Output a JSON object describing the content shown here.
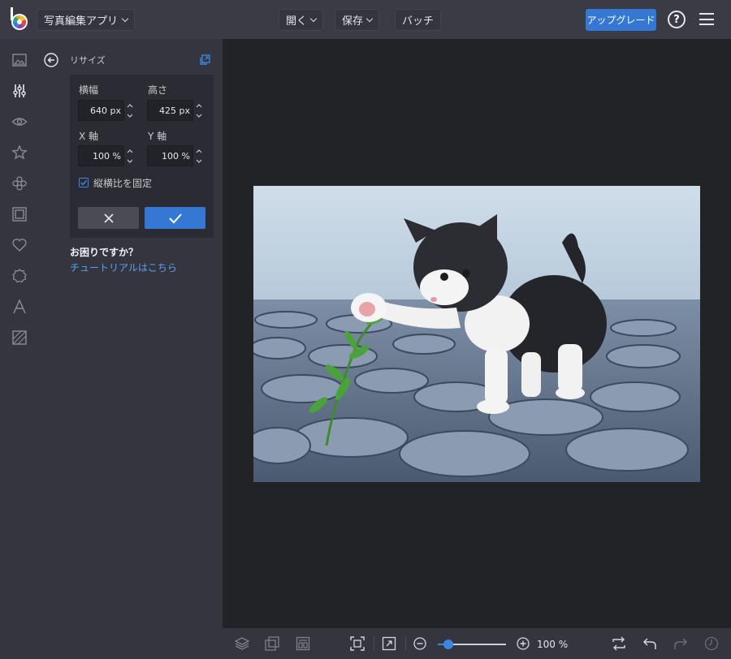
{
  "header": {
    "app_title": "写真編集アプリ",
    "open_label": "開く",
    "save_label": "保存",
    "batch_label": "バッチ",
    "upgrade_label": "アップグレード",
    "help_label": "?"
  },
  "sidebar": {
    "icons": [
      "image-icon",
      "sliders-icon",
      "eye-icon",
      "star-icon",
      "flower-icon",
      "frame-icon",
      "heart-icon",
      "badge-icon",
      "text-icon",
      "texture-icon"
    ],
    "active": "sliders-icon"
  },
  "panel": {
    "title": "リサイズ",
    "width_label": "横幅",
    "width_value": "640 px",
    "height_label": "高さ",
    "height_value": "425 px",
    "x_label": "X 軸",
    "x_value": "100 %",
    "y_label": "Y 軸",
    "y_value": "100 %",
    "lock_label": "縦横比を固定",
    "lock_checked": true,
    "help_question": "お困りですか？",
    "help_link": "チュートリアルはこちら"
  },
  "bottombar": {
    "zoom_value": "100 %",
    "zoom_level": 0.15
  },
  "colors": {
    "accent": "#3478d4",
    "topbar": "#3a3b45",
    "panel": "#34353e",
    "canvas": "#222326"
  }
}
